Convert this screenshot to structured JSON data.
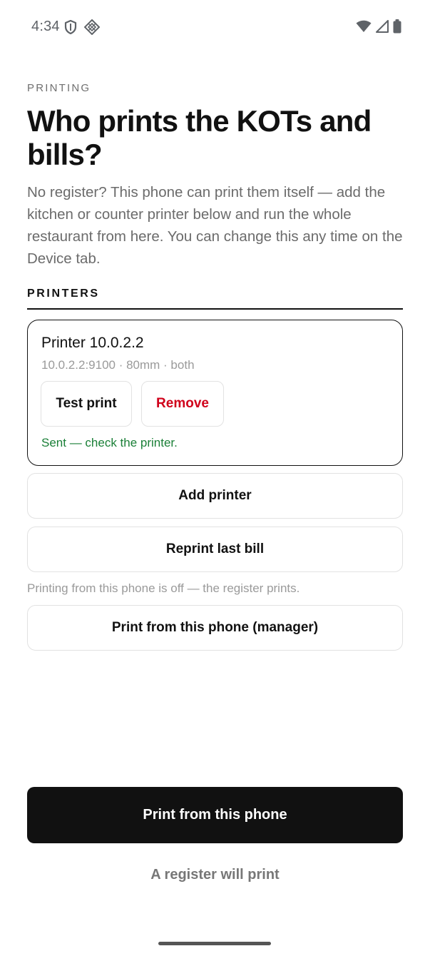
{
  "status_bar": {
    "time": "4:34",
    "left_icons": [
      "shield-icon",
      "diamond-grid-icon"
    ],
    "right_icons": [
      "wifi-icon",
      "signal-icon",
      "battery-icon"
    ]
  },
  "header": {
    "eyebrow": "PRINTING",
    "title": "Who prints the KOTs and bills?",
    "description": "No register? This phone can print them itself — add the kitchen or counter printer below and run the whole restaurant from here. You can change this any time on the Device tab."
  },
  "printers": {
    "section_label": "PRINTERS",
    "items": [
      {
        "name": "Printer 10.0.2.2",
        "meta": "10.0.2.2:9100 · 80mm · both",
        "test_label": "Test print",
        "remove_label": "Remove",
        "status": "Sent — check the printer."
      }
    ],
    "add_label": "Add printer",
    "reprint_label": "Reprint last bill",
    "phone_note": "Printing from this phone is off — the register prints.",
    "manager_label": "Print from this phone (manager)"
  },
  "footer": {
    "primary_label": "Print from this phone",
    "secondary_label": "A register will print"
  },
  "colors": {
    "primary": "#111111",
    "danger": "#d0021b",
    "success": "#1a7f37",
    "muted": "#9a9a9a"
  }
}
